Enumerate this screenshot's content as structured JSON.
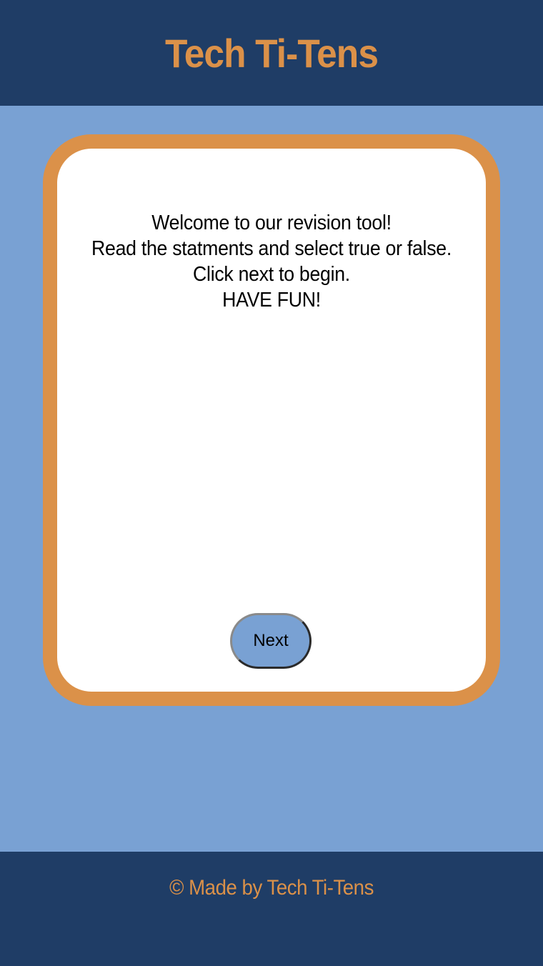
{
  "header": {
    "title": "Tech Ti-Tens"
  },
  "card": {
    "lines": [
      "Welcome to our revision tool!",
      "Read the statments and select true or false.",
      "Click next to begin.",
      "HAVE FUN!"
    ],
    "next_label": "Next"
  },
  "footer": {
    "text": "© Made by Tech Ti-Tens"
  },
  "colors": {
    "header_bg": "#1f3d66",
    "page_bg": "#79a1d3",
    "accent": "#db9149",
    "card_bg": "#ffffff",
    "button_bg": "#79a1d3"
  }
}
